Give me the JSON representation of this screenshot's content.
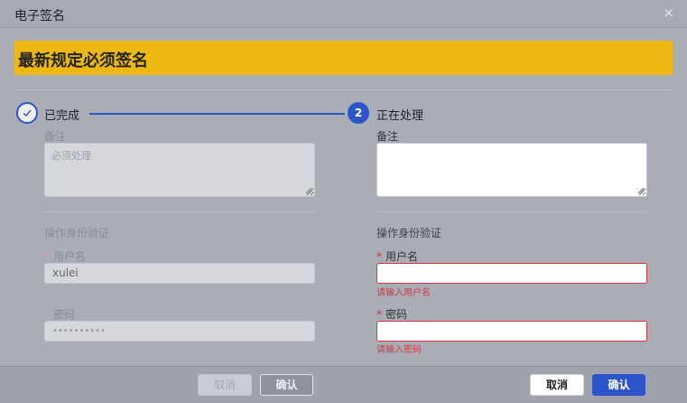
{
  "dialog": {
    "title": "电子签名",
    "close_glyph": "×"
  },
  "banner": {
    "text": "最新规定必须签名"
  },
  "steps": [
    {
      "label": "已完成",
      "status": "done",
      "icon": "check-icon"
    },
    {
      "label": "正在处理",
      "status": "active",
      "number": "2"
    }
  ],
  "left": {
    "remark_label": "备注",
    "remark_value": "必须处理",
    "section_title": "操作身份验证",
    "username_label": "用户名",
    "username_value": "xulei",
    "password_label": "密码",
    "password_value": "••••••••••",
    "cancel_label": "取消",
    "confirm_label": "确认"
  },
  "right": {
    "remark_label": "备注",
    "remark_value": "",
    "section_title": "操作身份验证",
    "username_label": "用户名",
    "username_value": "",
    "username_error": "请输入用户名",
    "password_label": "密码",
    "password_value": "",
    "password_error": "请输入密码",
    "cancel_label": "取消",
    "confirm_label": "确认"
  },
  "required_mark": "*",
  "colors": {
    "accent": "#2d55c9",
    "banner": "#edb911",
    "error": "#d9363e"
  }
}
